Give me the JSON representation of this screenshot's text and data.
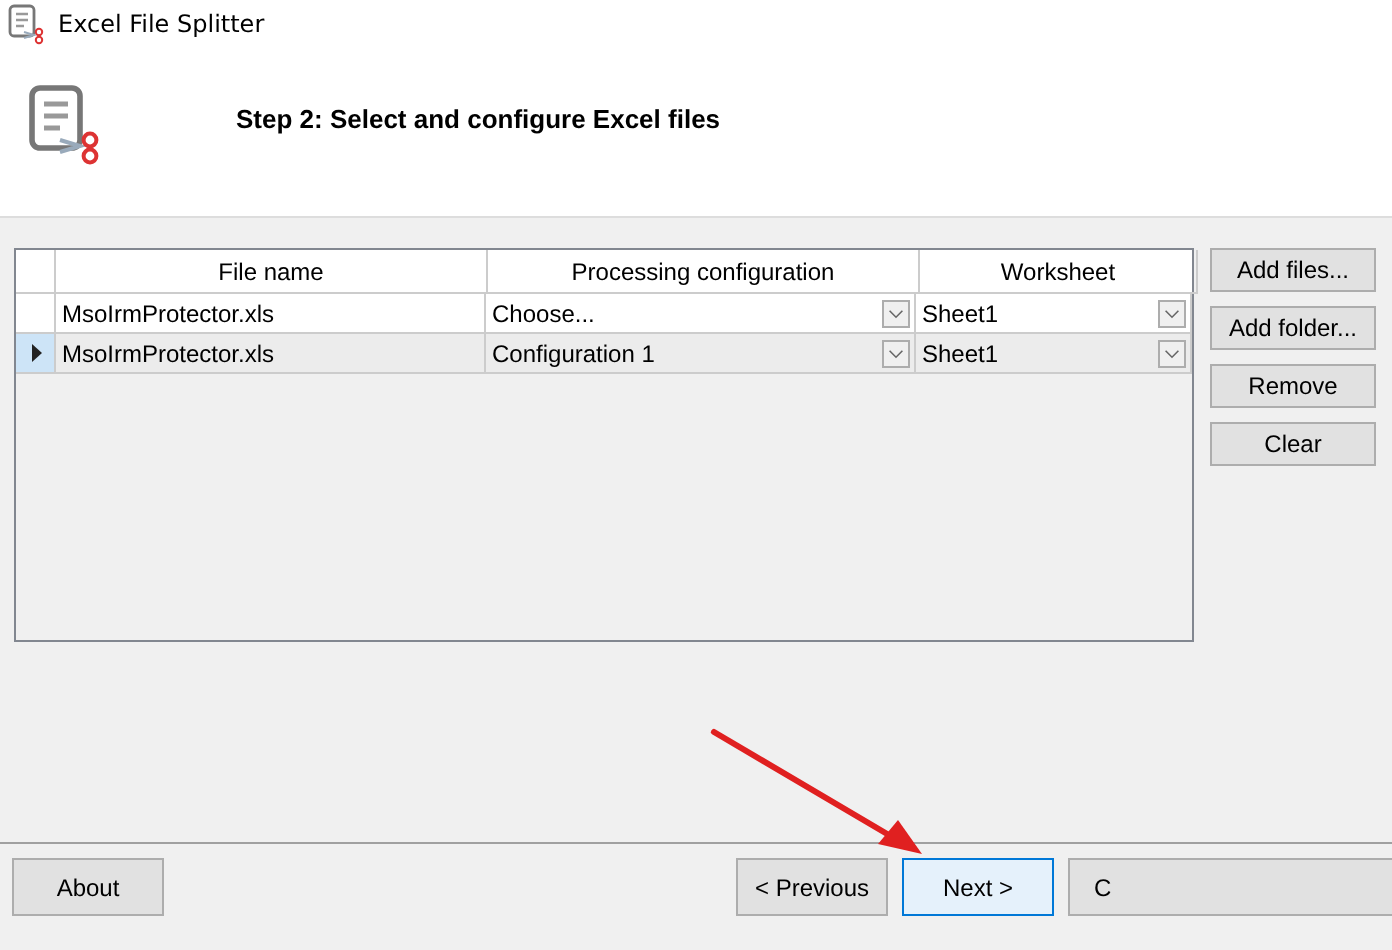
{
  "window": {
    "title": "Excel File Splitter"
  },
  "header": {
    "step": "Step 2: Select and configure Excel files"
  },
  "table": {
    "columns": [
      "File name",
      "Processing configuration",
      "Worksheet"
    ],
    "rows": [
      {
        "file": "MsoIrmProtector.xls",
        "configuration": "Choose...",
        "worksheet": "Sheet1",
        "selected": false
      },
      {
        "file": "MsoIrmProtector.xls",
        "configuration": "Configuration 1",
        "worksheet": "Sheet1",
        "selected": true
      }
    ]
  },
  "side_buttons": [
    "Add files...",
    "Add folder...",
    "Remove",
    "Clear"
  ],
  "footer": {
    "left_button": "About",
    "buttons": [
      {
        "label": "< Previous",
        "focused": false
      },
      {
        "label": "Next >",
        "focused": true
      },
      {
        "label": "C",
        "focused": false
      }
    ]
  }
}
